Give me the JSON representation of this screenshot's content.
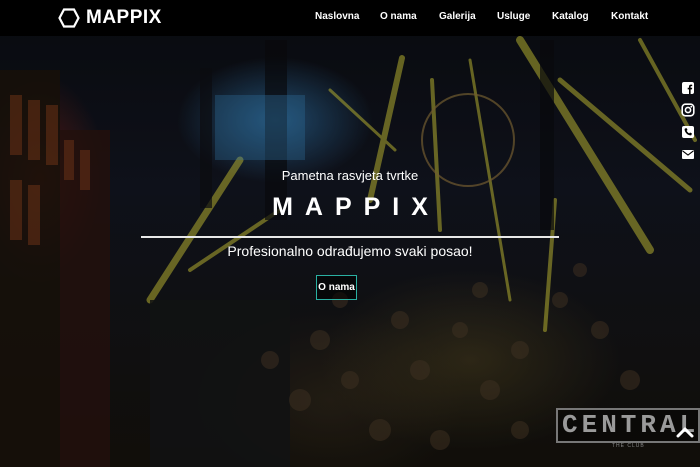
{
  "brand": {
    "name": "MAPPIX",
    "logo_icon": "hexagon-outline-icon"
  },
  "nav": {
    "items": [
      {
        "label": "Naslovna"
      },
      {
        "label": "O nama"
      },
      {
        "label": "Galerija"
      },
      {
        "label": "Usluge"
      },
      {
        "label": "Katalog"
      },
      {
        "label": "Kontakt"
      }
    ]
  },
  "social": {
    "icons": [
      "facebook-icon",
      "instagram-icon",
      "phone-icon",
      "envelope-icon"
    ]
  },
  "hero": {
    "tagline": "Pametna rasvjeta tvrtke",
    "title": "MAPPIX",
    "subtitle": "Profesionalno odrađujemo svaki posao!",
    "cta_label": "O nama",
    "accent_color": "#2ab0a2",
    "watermark_text": "CENTRAL",
    "watermark_subtext": "THE CLUB"
  },
  "scroll_top": {
    "icon": "chevron-up-icon"
  }
}
